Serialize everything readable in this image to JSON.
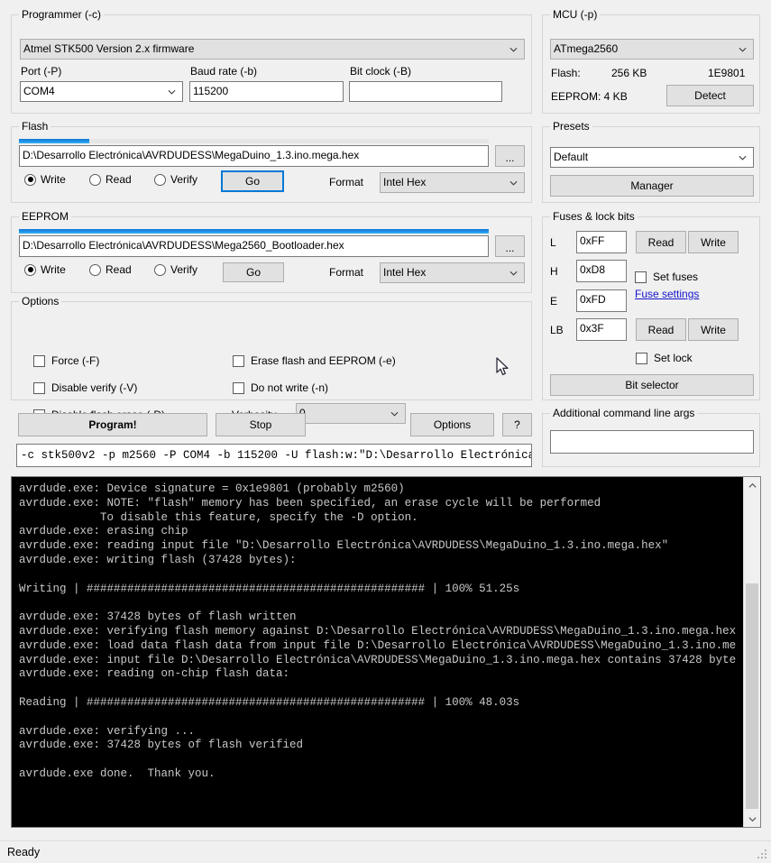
{
  "programmer": {
    "legend": "Programmer (-c)",
    "selected": "Atmel STK500 Version 2.x firmware",
    "port_label": "Port (-P)",
    "port_value": "COM4",
    "baud_label": "Baud rate (-b)",
    "baud_value": "115200",
    "bitclock_label": "Bit clock (-B)",
    "bitclock_value": ""
  },
  "mcu": {
    "legend": "MCU (-p)",
    "selected": "ATmega2560",
    "flash_label": "Flash:",
    "flash_value": "256 KB",
    "signature": "1E9801",
    "eeprom_label": "EEPROM: 4 KB",
    "detect_label": "Detect"
  },
  "flash": {
    "legend": "Flash",
    "file": "D:\\Desarrollo Electrónica\\AVRDUDESS\\MegaDuino_1.3.ino.mega.hex",
    "browse_label": "...",
    "write_label": "Write",
    "read_label": "Read",
    "verify_label": "Verify",
    "go_label": "Go",
    "format_label": "Format",
    "format_value": "Intel Hex",
    "progress_percent": 15
  },
  "eeprom": {
    "legend": "EEPROM",
    "file": "D:\\Desarrollo Electrónica\\AVRDUDESS\\Mega2560_Bootloader.hex",
    "browse_label": "...",
    "write_label": "Write",
    "read_label": "Read",
    "verify_label": "Verify",
    "go_label": "Go",
    "format_label": "Format",
    "format_value": "Intel Hex",
    "progress_percent": 100
  },
  "presets": {
    "legend": "Presets",
    "selected": "Default",
    "manager_label": "Manager"
  },
  "options": {
    "legend": "Options",
    "force_label": "Force (-F)",
    "disable_verify_label": "Disable verify (-V)",
    "disable_flash_erase_label": "Disable flash erase (-D)",
    "erase_flash_eeprom_label": "Erase flash and EEPROM (-e)",
    "do_not_write_label": "Do not write (-n)",
    "verbosity_label": "Verbosity",
    "verbosity_value": "0"
  },
  "fuses": {
    "legend": "Fuses & lock bits",
    "l_label": "L",
    "l_value": "0xFF",
    "h_label": "H",
    "h_value": "0xD8",
    "e_label": "E",
    "e_value": "0xFD",
    "lb_label": "LB",
    "lb_value": "0x3F",
    "read_label": "Read",
    "write_label": "Write",
    "read2_label": "Read",
    "write2_label": "Write",
    "set_fuses_label": "Set fuses",
    "fuse_settings_link": "Fuse settings",
    "set_lock_label": "Set lock",
    "bit_selector_label": "Bit selector"
  },
  "actions": {
    "program_label": "Program!",
    "stop_label": "Stop",
    "options_label": "Options",
    "help_label": "?"
  },
  "cmdline": {
    "value": "-c stk500v2 -p m2560 -P COM4 -b 115200 -U flash:w:\"D:\\Desarrollo Electrónica"
  },
  "extra_args": {
    "legend": "Additional command line args",
    "value": ""
  },
  "console": {
    "lines": [
      "avrdude.exe: Device signature = 0x1e9801 (probably m2560)",
      "avrdude.exe: NOTE: \"flash\" memory has been specified, an erase cycle will be performed",
      "            To disable this feature, specify the -D option.",
      "avrdude.exe: erasing chip",
      "avrdude.exe: reading input file \"D:\\Desarrollo Electrónica\\AVRDUDESS\\MegaDuino_1.3.ino.mega.hex\"",
      "avrdude.exe: writing flash (37428 bytes):",
      "",
      "Writing | ################################################## | 100% 51.25s",
      "",
      "avrdude.exe: 37428 bytes of flash written",
      "avrdude.exe: verifying flash memory against D:\\Desarrollo Electrónica\\AVRDUDESS\\MegaDuino_1.3.ino.mega.hex",
      "avrdude.exe: load data flash data from input file D:\\Desarrollo Electrónica\\AVRDUDESS\\MegaDuino_1.3.ino.me",
      "avrdude.exe: input file D:\\Desarrollo Electrónica\\AVRDUDESS\\MegaDuino_1.3.ino.mega.hex contains 37428 byte",
      "avrdude.exe: reading on-chip flash data:",
      "",
      "Reading | ################################################## | 100% 48.03s",
      "",
      "avrdude.exe: verifying ...",
      "avrdude.exe: 37428 bytes of flash verified",
      "",
      "avrdude.exe done.  Thank you."
    ]
  },
  "statusbar": {
    "text": "Ready"
  }
}
